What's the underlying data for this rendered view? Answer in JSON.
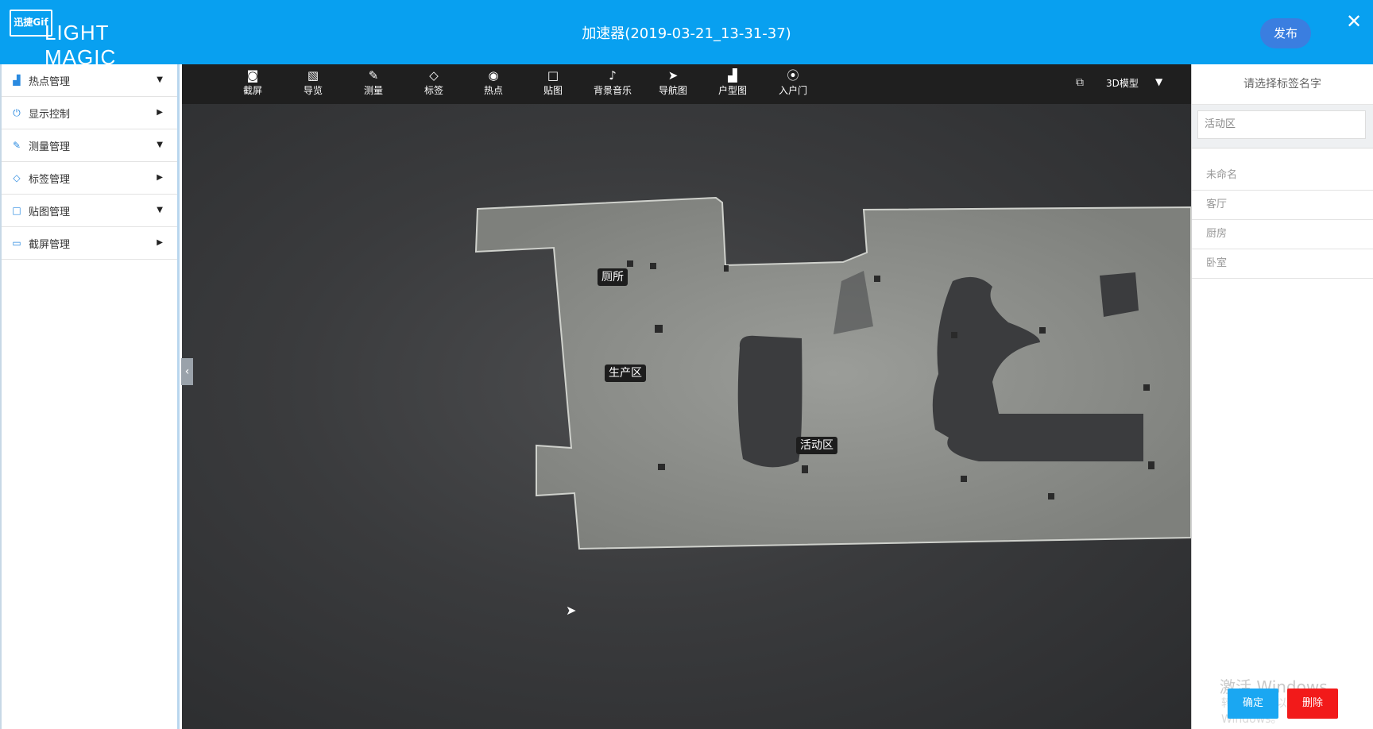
{
  "header": {
    "logo_badge": "迅捷Gif",
    "logo_text": "LIGHT MAGIC",
    "title": "加速器(2019-03-21_13-31-37)",
    "publish_label": "发布",
    "close_label": "✕",
    "color": "#08a0f0"
  },
  "sidebar": {
    "items": [
      {
        "label": "热点管理",
        "icon": "chart-icon",
        "arrow": "▼"
      },
      {
        "label": "显示控制",
        "icon": "power-icon",
        "arrow": "▶"
      },
      {
        "label": "测量管理",
        "icon": "ruler-icon",
        "arrow": "▼"
      },
      {
        "label": "标签管理",
        "icon": "tag-icon",
        "arrow": "▶"
      },
      {
        "label": "贴图管理",
        "icon": "square-icon",
        "arrow": "▼"
      },
      {
        "label": "截屏管理",
        "icon": "screenshot-icon",
        "arrow": "▶"
      }
    ]
  },
  "toolbar": {
    "tools": [
      {
        "label": "截屏",
        "icon": "camera-icon",
        "glyph": "◙"
      },
      {
        "label": "导览",
        "icon": "image-icon",
        "glyph": "▧"
      },
      {
        "label": "测量",
        "icon": "pencil-icon",
        "glyph": "✎"
      },
      {
        "label": "标签",
        "icon": "tag-icon",
        "glyph": "◇"
      },
      {
        "label": "热点",
        "icon": "target-icon",
        "glyph": "◉"
      },
      {
        "label": "贴图",
        "icon": "square-icon",
        "glyph": "□"
      },
      {
        "label": "背景音乐",
        "icon": "music-icon",
        "glyph": "♪"
      },
      {
        "label": "导航图",
        "icon": "navigation-icon",
        "glyph": "➤"
      },
      {
        "label": "户型图",
        "icon": "floorplan-icon",
        "glyph": "▟"
      },
      {
        "label": "入户门",
        "icon": "location-pin-icon",
        "glyph": "⦿"
      }
    ],
    "view_mode": "3D模型",
    "view_caret": "▼"
  },
  "viewport": {
    "room_labels": [
      "厕所",
      "生产区",
      "活动区"
    ]
  },
  "right_panel": {
    "title": "请选择标签名字",
    "input_value": "活动区",
    "options": [
      "未命名",
      "客厅",
      "厨房",
      "卧室"
    ],
    "watermark_line1": "激活 Windows",
    "watermark_line2": "转到\"设置\"以激活 Windows。",
    "confirm_label": "确定",
    "delete_label": "删除"
  }
}
